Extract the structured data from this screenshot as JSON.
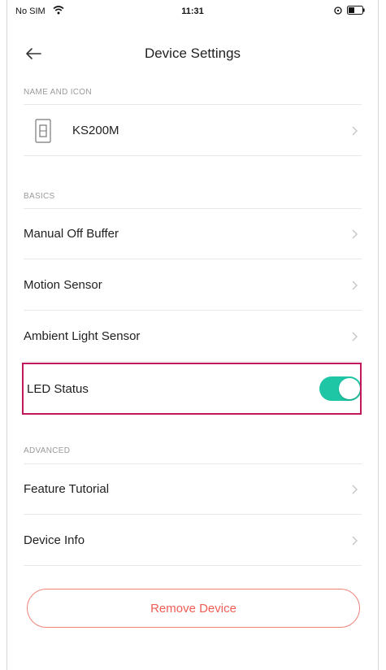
{
  "status_bar": {
    "carrier": "No SIM",
    "time": "11:31",
    "icons": [
      "wifi-icon",
      "lock-icon",
      "battery-icon"
    ]
  },
  "header": {
    "title": "Device Settings",
    "back_icon": "arrow-left-icon"
  },
  "sections": {
    "name_and_icon": {
      "label": "NAME AND ICON",
      "device": {
        "name": "KS200M",
        "icon": "light-switch-icon"
      }
    },
    "basics": {
      "label": "BASICS",
      "items": [
        {
          "label": "Manual Off Buffer"
        },
        {
          "label": "Motion Sensor"
        },
        {
          "label": "Ambient Light Sensor"
        },
        {
          "label": "LED Status",
          "toggle_on": true
        }
      ]
    },
    "advanced": {
      "label": "ADVANCED",
      "items": [
        {
          "label": "Feature Tutorial"
        },
        {
          "label": "Device Info"
        }
      ]
    }
  },
  "actions": {
    "remove_label": "Remove Device"
  },
  "colors": {
    "toggle_on": "#1ec6a6",
    "remove_accent": "#ef5d55",
    "highlight": "#c2185b"
  }
}
